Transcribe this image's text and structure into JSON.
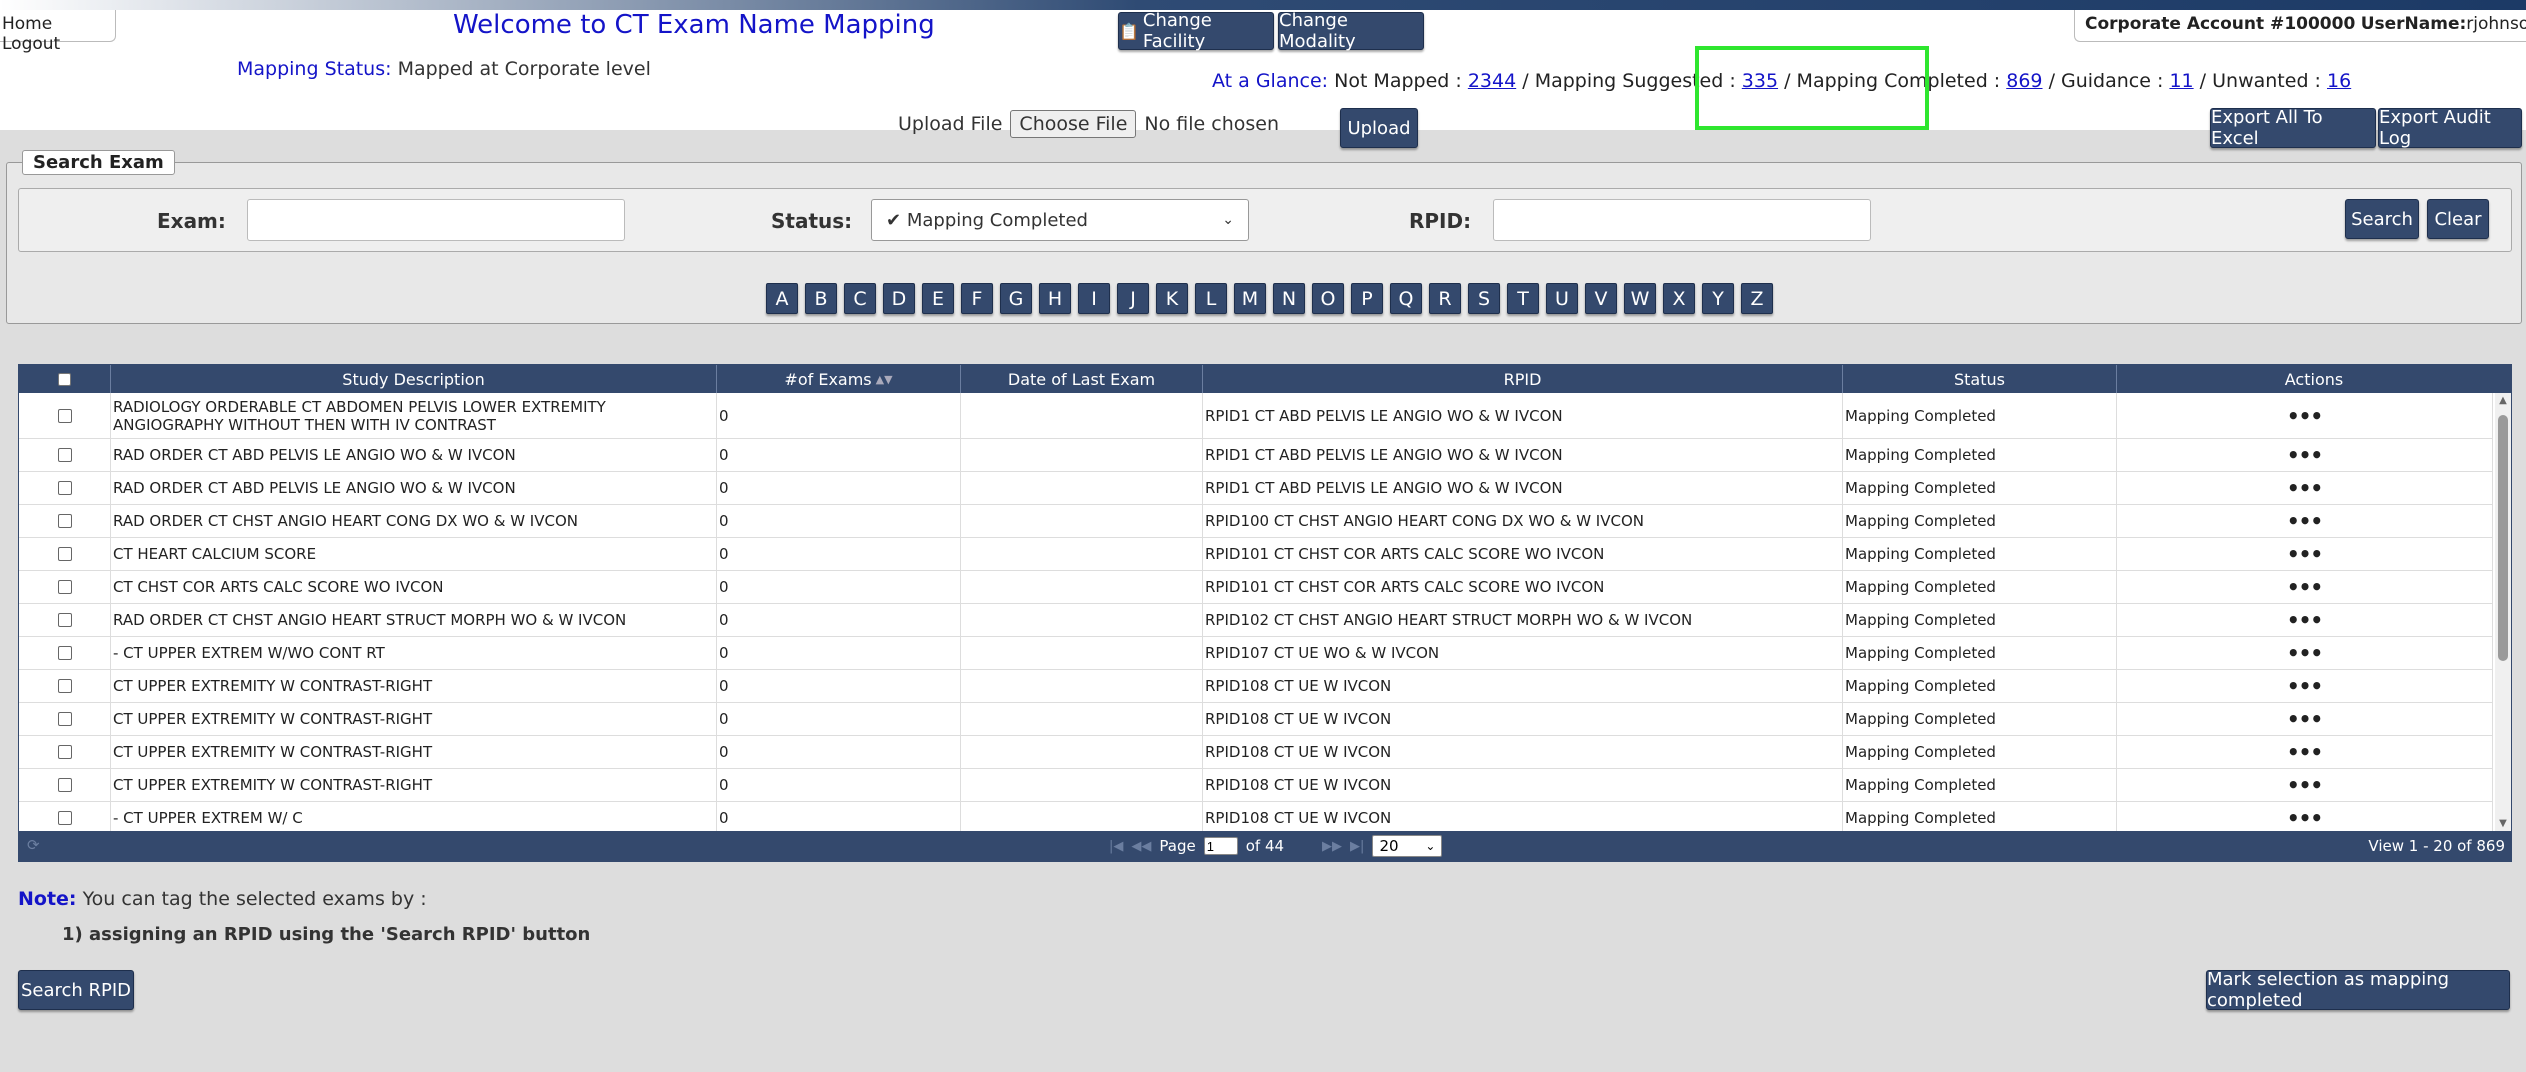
{
  "header": {
    "home_label": "Home",
    "logout_label": "Logout",
    "welcome": "Welcome to CT Exam Name Mapping",
    "mapping_status_label": "Mapping Status:",
    "mapping_status_value": "Mapped at Corporate level",
    "change_facility": "Change Facility",
    "change_modality": "Change Modality",
    "account_label": "Corporate Account #",
    "account_number": "100000",
    "username_label": "UserName:",
    "username": "rjohnson@acr.org"
  },
  "glance": {
    "label": "At a Glance:",
    "not_mapped_label": "Not Mapped :",
    "not_mapped": "2344",
    "suggested_label": "Mapping Suggested :",
    "suggested": "335",
    "completed_label": "Mapping Completed :",
    "completed": "869",
    "guidance_label": "Guidance :",
    "guidance": "11",
    "unwanted_label": "Unwanted :",
    "unwanted": "16",
    "sep": "/",
    "highlight_color": "#2ee62e"
  },
  "upload": {
    "label": "Upload File",
    "choose": "Choose File",
    "no_file": "No file chosen",
    "upload_button": "Upload",
    "export_excel": "Export All To Excel",
    "export_audit": "Export Audit Log"
  },
  "search": {
    "legend": "Search Exam",
    "exam_label": "Exam:",
    "exam_value": "",
    "status_label": "Status:",
    "status_value": "Mapping Completed",
    "rpid_label": "RPID:",
    "rpid_value": "",
    "search_button": "Search",
    "clear_button": "Clear",
    "letters": [
      "A",
      "B",
      "C",
      "D",
      "E",
      "F",
      "G",
      "H",
      "I",
      "J",
      "K",
      "L",
      "M",
      "N",
      "O",
      "P",
      "Q",
      "R",
      "S",
      "T",
      "U",
      "V",
      "W",
      "X",
      "Y",
      "Z"
    ]
  },
  "grid": {
    "columns": [
      "Study Description",
      "#of Exams",
      "Date of Last Exam",
      "RPID",
      "Status",
      "Actions"
    ],
    "rows": [
      {
        "desc": "RADIOLOGY ORDERABLE CT ABDOMEN PELVIS LOWER EXTREMITY ANGIOGRAPHY WITHOUT THEN WITH IV CONTRAST",
        "exams": "0",
        "date": "",
        "rpid": "RPID1 CT ABD PELVIS LE ANGIO WO & W IVCON",
        "status": "Mapping Completed"
      },
      {
        "desc": "RAD ORDER CT ABD PELVIS LE ANGIO WO & W IVCON",
        "exams": "0",
        "date": "",
        "rpid": "RPID1 CT ABD PELVIS LE ANGIO WO & W IVCON",
        "status": "Mapping Completed"
      },
      {
        "desc": "RAD ORDER CT ABD PELVIS LE ANGIO WO & W IVCON",
        "exams": "0",
        "date": "",
        "rpid": "RPID1 CT ABD PELVIS LE ANGIO WO & W IVCON",
        "status": "Mapping Completed"
      },
      {
        "desc": "RAD ORDER CT CHST ANGIO HEART CONG DX WO & W IVCON",
        "exams": "0",
        "date": "",
        "rpid": "RPID100 CT CHST ANGIO HEART CONG DX WO & W IVCON",
        "status": "Mapping Completed"
      },
      {
        "desc": "CT HEART CALCIUM SCORE",
        "exams": "0",
        "date": "",
        "rpid": "RPID101 CT CHST COR ARTS CALC SCORE WO IVCON",
        "status": "Mapping Completed"
      },
      {
        "desc": "CT CHST COR ARTS CALC SCORE WO IVCON",
        "exams": "0",
        "date": "",
        "rpid": "RPID101 CT CHST COR ARTS CALC SCORE WO IVCON",
        "status": "Mapping Completed"
      },
      {
        "desc": "RAD ORDER CT CHST ANGIO HEART STRUCT MORPH WO & W IVCON",
        "exams": "0",
        "date": "",
        "rpid": "RPID102 CT CHST ANGIO HEART STRUCT MORPH WO & W IVCON",
        "status": "Mapping Completed"
      },
      {
        "desc": "- CT UPPER EXTREM W/WO CONT RT",
        "exams": "0",
        "date": "",
        "rpid": "RPID107 CT UE WO & W IVCON",
        "status": "Mapping Completed"
      },
      {
        "desc": "CT UPPER EXTREMITY W CONTRAST-RIGHT",
        "exams": "0",
        "date": "",
        "rpid": "RPID108 CT UE W IVCON",
        "status": "Mapping Completed"
      },
      {
        "desc": "CT UPPER EXTREMITY W CONTRAST-RIGHT",
        "exams": "0",
        "date": "",
        "rpid": "RPID108 CT UE W IVCON",
        "status": "Mapping Completed"
      },
      {
        "desc": "CT UPPER EXTREMITY W CONTRAST-RIGHT",
        "exams": "0",
        "date": "",
        "rpid": "RPID108 CT UE W IVCON",
        "status": "Mapping Completed"
      },
      {
        "desc": "CT UPPER EXTREMITY W CONTRAST-RIGHT",
        "exams": "0",
        "date": "",
        "rpid": "RPID108 CT UE W IVCON",
        "status": "Mapping Completed"
      },
      {
        "desc": "- CT UPPER EXTREM W/ C",
        "exams": "0",
        "date": "",
        "rpid": "RPID108 CT UE W IVCON",
        "status": "Mapping Completed"
      }
    ],
    "actions_glyph": "•••"
  },
  "pager": {
    "page_label": "Page",
    "page_value": "1",
    "of_label": "of 44",
    "page_size": "20",
    "view_text": "View 1 - 20 of 869"
  },
  "note": {
    "label": "Note:",
    "text": "You can tag the selected exams by :",
    "item1": "1) assigning an RPID using the 'Search RPID' button",
    "search_rpid": "Search RPID",
    "mark_completed": "Mark selection as mapping completed"
  }
}
